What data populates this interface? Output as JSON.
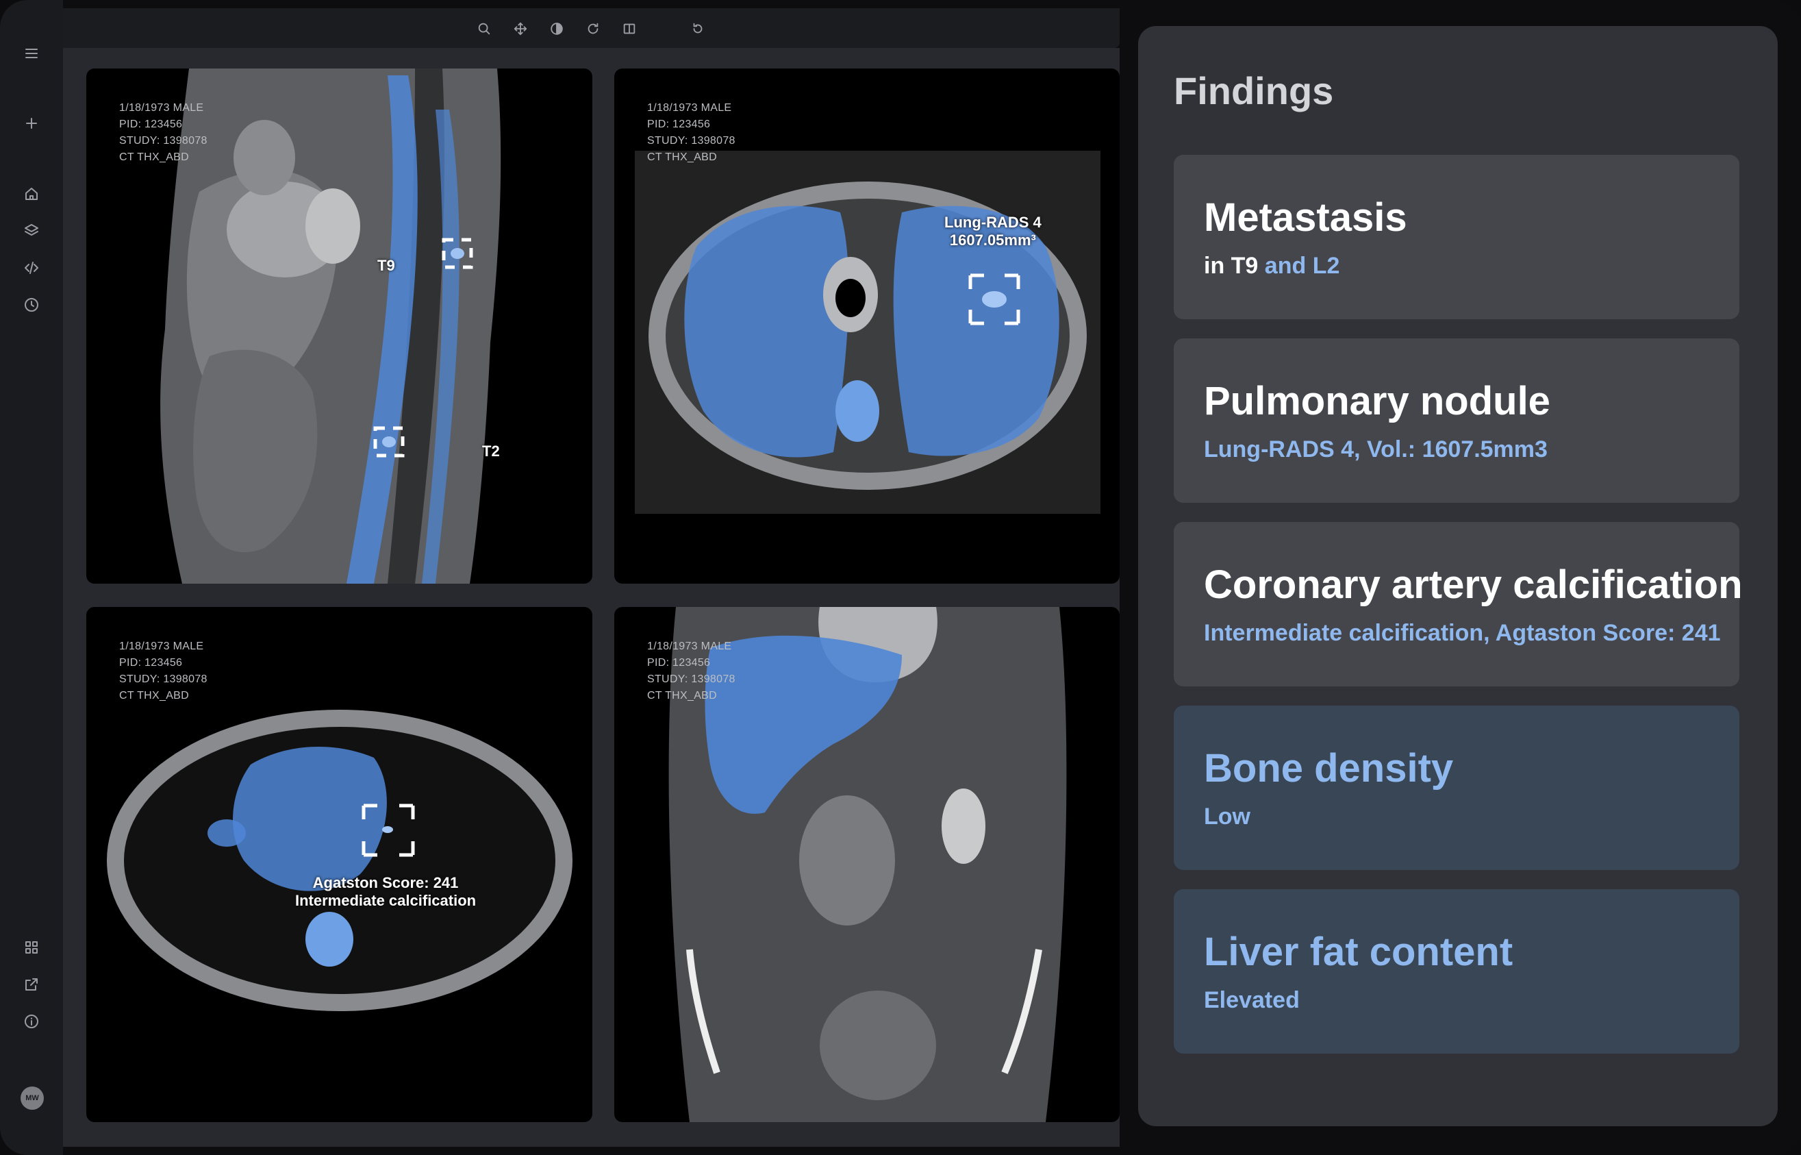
{
  "sidebar": {
    "top_icons": [
      "menu-icon",
      "plus-icon",
      "home-icon",
      "layers-icon",
      "code-icon",
      "clock-icon"
    ],
    "bottom_icons": [
      "grid-icon",
      "external-link-icon",
      "info-icon"
    ],
    "avatar_initials": "MW"
  },
  "toolbar": {
    "tools": [
      "zoom-icon",
      "pan-icon",
      "contrast-icon",
      "rotate-icon",
      "flip-icon",
      "undo-icon"
    ]
  },
  "viewports": {
    "sagittal": {
      "meta": [
        "1/18/1973 MALE",
        "PID: 123456",
        "STUDY: 1398078",
        "CT THX_ABD"
      ],
      "label_t9": "T9",
      "label_t2": "T2"
    },
    "axial_lung": {
      "meta": [
        "1/18/1973 MALE",
        "PID: 123456",
        "STUDY: 1398078",
        "CT THX_ABD"
      ],
      "label_line1": "Lung-RADS 4",
      "label_line2": "1607.05mm³"
    },
    "axial_heart": {
      "meta": [
        "1/18/1973 MALE",
        "PID: 123456",
        "STUDY: 1398078",
        "CT THX_ABD"
      ],
      "label_line1": "Agatston Score: 241",
      "label_line2": "Intermediate calcification"
    },
    "coronal": {
      "meta": [
        "1/18/1973 MALE",
        "PID: 123456",
        "STUDY: 1398078",
        "CT THX_ABD"
      ]
    }
  },
  "findings": {
    "title": "Findings",
    "cards": [
      {
        "title": "Metastasis",
        "sub_white": "in T9",
        "sub_blue": "and L2"
      },
      {
        "title": "Pulmonary nodule",
        "sub_blue": "Lung-RADS 4, Vol.: 1607.5mm3"
      },
      {
        "title": "Coronary artery calcification",
        "sub_blue": "Intermediate calcification, Agtaston Score: 241"
      },
      {
        "title": "Bone density",
        "sub_blue": "Low"
      },
      {
        "title": "Liver fat content",
        "sub_blue": "Elevated"
      }
    ]
  },
  "colors": {
    "accent_blue": "#8fb8ee",
    "segmentation_blue": "#4f86d6",
    "highlight_card": "#394656",
    "card": "#45464c",
    "panel": "#313237"
  }
}
